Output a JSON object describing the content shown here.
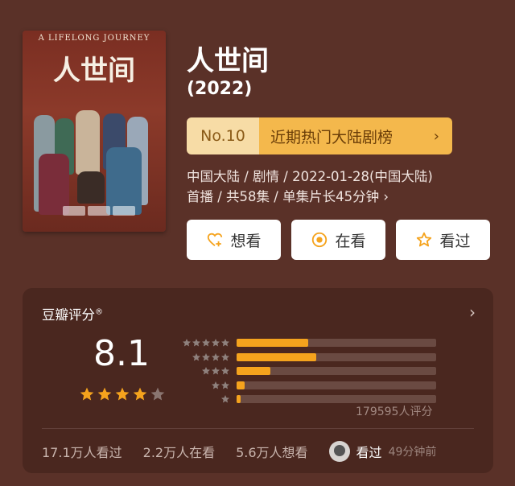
{
  "poster": {
    "title_en": "A LIFELONG JOURNEY",
    "title_cn": "人世间"
  },
  "show": {
    "title": "人世间",
    "year": "(2022)"
  },
  "rank": {
    "number": "No.10",
    "label": "近期热门大陆剧榜",
    "chevron": "›"
  },
  "meta": {
    "line1": "中国大陆 / 剧情 / 2022-01-28(中国大陆)",
    "line2": "首播 / 共58集 / 单集片长45分钟 ›"
  },
  "actions": {
    "want": {
      "label": "想看",
      "icon": "heart-plus-icon"
    },
    "watching": {
      "label": "在看",
      "icon": "target-icon"
    },
    "watched": {
      "label": "看过",
      "icon": "star-outline-icon"
    }
  },
  "rating": {
    "title": "豆瓣评分",
    "registered": "®",
    "chevron": "›",
    "score": "8.1",
    "stars_filled": 4,
    "stars_total": 5,
    "distribution": [
      {
        "stars": 5,
        "fraction": 0.36
      },
      {
        "stars": 4,
        "fraction": 0.4
      },
      {
        "stars": 3,
        "fraction": 0.17
      },
      {
        "stars": 2,
        "fraction": 0.04
      },
      {
        "stars": 1,
        "fraction": 0.02
      }
    ],
    "count_text": "179595人评分"
  },
  "stats": {
    "watched": "17.1万人看过",
    "watching": "2.2万人在看",
    "want": "5.6万人想看",
    "me_label": "看过",
    "me_time": "49分钟前"
  },
  "colors": {
    "background": "#5a3128",
    "card": "#4a271f",
    "accent": "#f5a31d",
    "rank_no_bg": "#f7dca6",
    "rank_text_bg": "#f4b84c"
  }
}
